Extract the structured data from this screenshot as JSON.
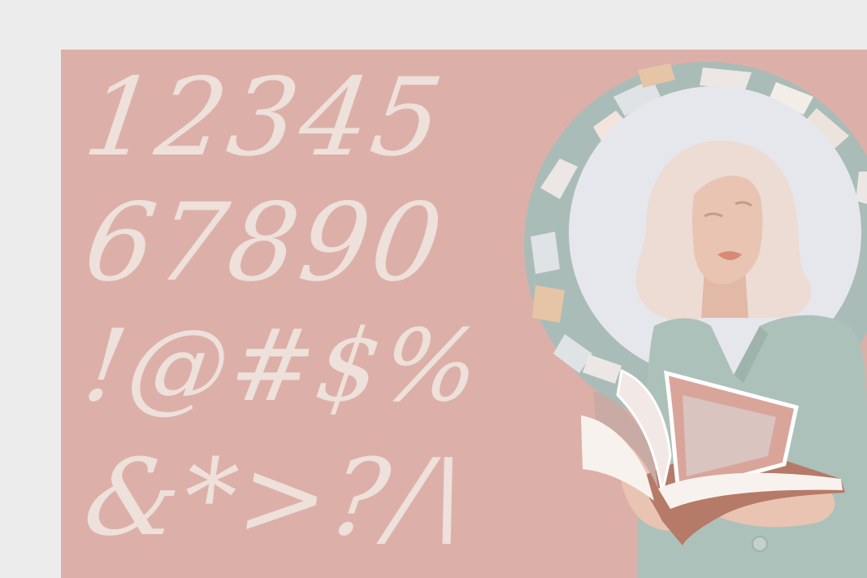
{
  "glyphs": {
    "row_1": "12345",
    "row_2": "67890",
    "row_3": "!@#$%",
    "row_4": "&*>?/\\"
  },
  "colors": {
    "page_background": "#ececec",
    "card_background": "#dcb0a8",
    "glyph_color": "#eee0da",
    "halo_sage": "#a9bcb8",
    "halo_light": "#e6e7ec",
    "hair": "#ecdcd4",
    "skin": "#e9c4b2",
    "lips": "#d88a79",
    "blouse": "#adc1bb",
    "book_cover": "#b67a69"
  },
  "illustration": {
    "subject": "woman-reading-book-icon"
  }
}
